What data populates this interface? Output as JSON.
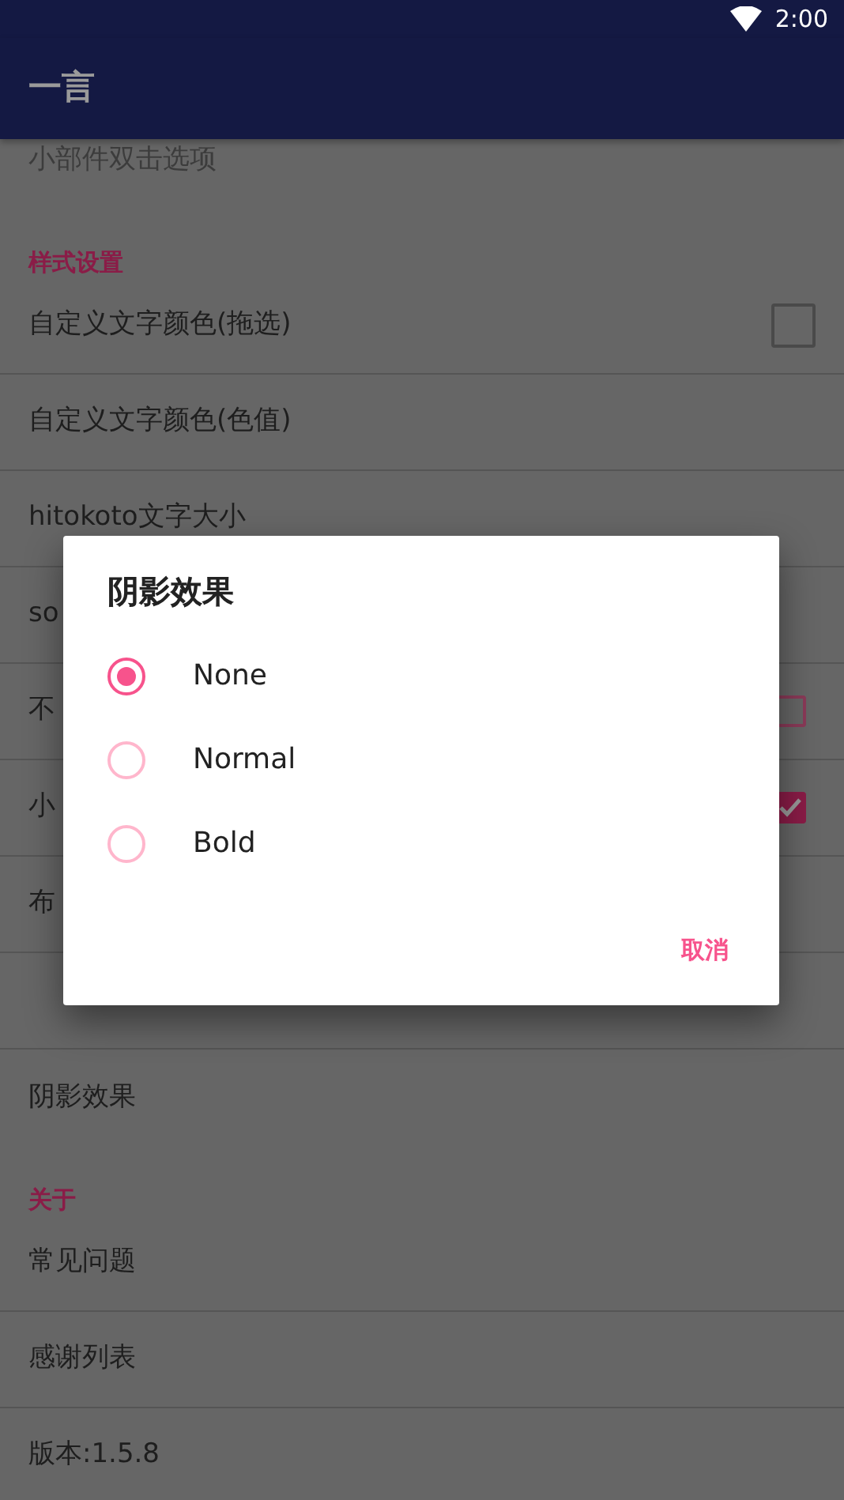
{
  "status_bar": {
    "time": "2:00"
  },
  "app_bar": {
    "title": "一言"
  },
  "settings": [
    {
      "kind": "item",
      "label": "小部件双击选项"
    },
    {
      "kind": "header",
      "label": "样式设置"
    },
    {
      "kind": "checkbox",
      "label": "自定义文字颜色(拖选)",
      "checked": false,
      "disabled": true
    },
    {
      "kind": "item",
      "label": "自定义文字颜色(色值)"
    },
    {
      "kind": "item",
      "label": "hitokoto文字大小"
    },
    {
      "kind": "item",
      "label": "so"
    },
    {
      "kind": "checkbox",
      "label": "不",
      "checked": false,
      "disabled": false
    },
    {
      "kind": "checkbox",
      "label": "小",
      "checked": true,
      "disabled": false
    },
    {
      "kind": "item",
      "label": "布"
    },
    {
      "kind": "item"
    },
    {
      "kind": "item",
      "label": "阴影效果"
    },
    {
      "kind": "header",
      "label": "关于"
    },
    {
      "kind": "item",
      "label": "常见问题"
    },
    {
      "kind": "item",
      "label": "感谢列表"
    },
    {
      "kind": "item",
      "label": "版本:1.5.8"
    }
  ],
  "dialog": {
    "title": "阴影效果",
    "options": [
      {
        "label": "None",
        "selected": true
      },
      {
        "label": "Normal",
        "selected": false
      },
      {
        "label": "Bold",
        "selected": false
      }
    ],
    "buttons": [
      "取消"
    ]
  }
}
